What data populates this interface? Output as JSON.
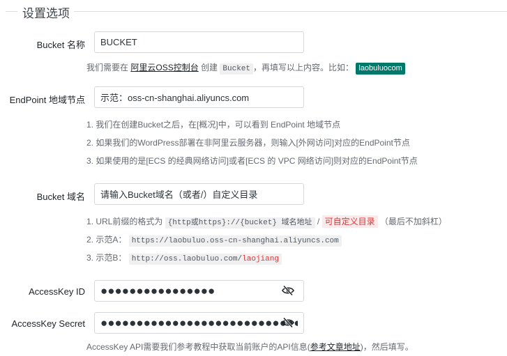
{
  "section": {
    "title": "设置选项"
  },
  "bucket_name": {
    "label": "Bucket 名称",
    "value": "BUCKET",
    "help_prefix": "我们需要在",
    "help_link": "阿里云OSS控制台",
    "help_mid": "创建",
    "help_code": "Bucket",
    "help_suffix": "，再填写以上内容。比如：",
    "help_badge": "laobuluocom"
  },
  "endpoint": {
    "label": "EndPoint 地域节点",
    "value": "示范：oss-cn-shanghai.aliyuncs.com",
    "notes": [
      "1. 我们在创建Bucket之后，在[概况]中，可以看到 EndPoint 地域节点",
      "2. 如果我们的WordPress部署在非阿里云服务器，则输入[外网访问]对应的EndPoint节点",
      "3. 如果使用的是[ECS 的经典网络访问]或者[ECS 的 VPC 网络访问]则对应的EndPoint节点"
    ]
  },
  "bucket_domain": {
    "label": "Bucket 域名",
    "value": "请输入Bucket域名（或者/）自定义目录",
    "note1_prefix": "1. URL前缀的格式为",
    "note1_code": "{http或https}://{bucket} 域名地址",
    "note1_sep": "/",
    "note1_custom": "可自定义目录",
    "note1_suffix": "（最后不加斜杠）",
    "note2_prefix": "2. 示范A：",
    "note2_code": "https://laobuluo.oss-cn-shanghai.aliyuncs.com",
    "note3_prefix": "3. 示范B：",
    "note3_code_plain": "http://oss.laobuluo.com/",
    "note3_code_red": "laojiang"
  },
  "access_key_id": {
    "label": "AccessKey ID",
    "value": "●●●●●●●●●●●●●●●●"
  },
  "access_key_secret": {
    "label": "AccessKey Secret",
    "value": "●●●●●●●●●●●●●●●●●●●●●●●●●●●●●●",
    "help_prefix": "AccessKey API需要我们参考教程中获取当前账户的API信息(",
    "help_link": "参考文章地址",
    "help_suffix": ")，然后填写。"
  },
  "icons": {
    "visibility_toggle": "eye-slash-icon"
  }
}
